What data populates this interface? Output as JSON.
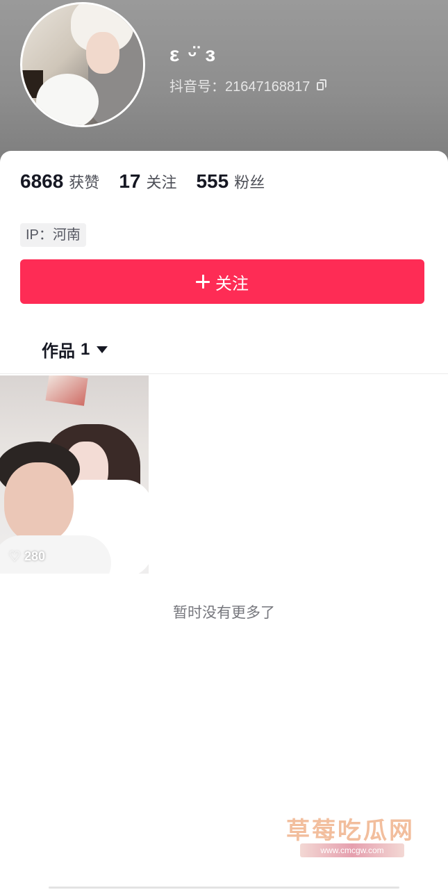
{
  "profile": {
    "nickname": "ε ᵕ̈ ɜ",
    "douyin_id": "抖音号：21647168817"
  },
  "stats": [
    {
      "value": "6868",
      "label": "获赞"
    },
    {
      "value": "17",
      "label": "关注"
    },
    {
      "value": "555",
      "label": "粉丝"
    }
  ],
  "ip": "IP：河南",
  "follow_button": {
    "label": "关注",
    "color": "#fe2c55"
  },
  "tabs": {
    "works_label": "作品",
    "works_count": "1"
  },
  "videos": [
    {
      "likes": "280"
    }
  ],
  "footer_text": "暂时没有更多了",
  "watermark": {
    "title": "草莓吃瓜网",
    "url": "www.cmcgw.com"
  }
}
